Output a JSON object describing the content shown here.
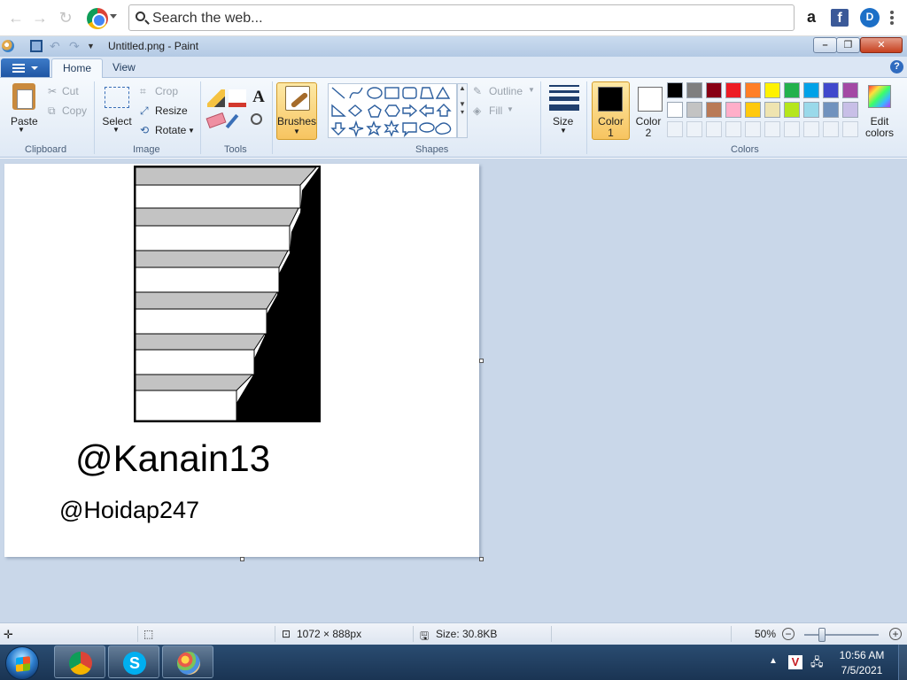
{
  "browser": {
    "omnibox_placeholder": "Search the web...",
    "extensions": [
      "amazon-icon",
      "facebook-icon",
      "dashlane-icon"
    ]
  },
  "paint": {
    "window_title": "Untitled.png - Paint",
    "tabs": {
      "home": "Home",
      "view": "View"
    },
    "clipboard": {
      "paste": "Paste",
      "cut": "Cut",
      "copy": "Copy",
      "group": "Clipboard"
    },
    "image": {
      "select": "Select",
      "crop": "Crop",
      "resize": "Resize",
      "rotate": "Rotate",
      "group": "Image"
    },
    "tools": {
      "group": "Tools",
      "text_tool": "A"
    },
    "brushes": {
      "label": "Brushes"
    },
    "shapes": {
      "outline": "Outline",
      "fill": "Fill",
      "group": "Shapes"
    },
    "size": {
      "label": "Size"
    },
    "colors": {
      "color1_label": "Color",
      "color1_num": "1",
      "color2_label": "Color",
      "color2_num": "2",
      "color1_value": "#000000",
      "color2_value": "#ffffff",
      "edit_label": "Edit",
      "edit_label2": "colors",
      "group": "Colors",
      "palette_row1": [
        "#000000",
        "#7f7f7f",
        "#880015",
        "#ed1c24",
        "#ff7f27",
        "#fff200",
        "#22b14c",
        "#00a2e8",
        "#3f48cc",
        "#a349a4"
      ],
      "palette_row2": [
        "#ffffff",
        "#c3c3c3",
        "#b97a57",
        "#ffaec9",
        "#ffc90e",
        "#efe4b0",
        "#b5e61d",
        "#99d9ea",
        "#7092be",
        "#c8bfe7"
      ]
    },
    "canvas": {
      "watermark_main": "@Kanain13",
      "watermark_sub": "@Hoidap247"
    },
    "status": {
      "dimensions": "1072 × 888px",
      "size": "Size: 30.8KB",
      "zoom": "50%"
    }
  },
  "taskbar": {
    "time": "10:56 AM",
    "date": "7/5/2021",
    "apps": [
      "chrome-icon",
      "skype-icon",
      "paint-icon"
    ]
  }
}
